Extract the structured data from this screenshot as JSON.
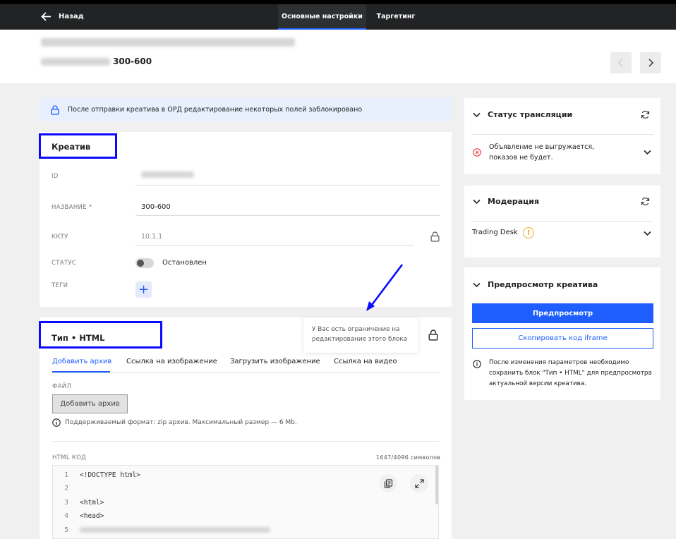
{
  "topbar": {
    "back_label": "Назад",
    "tabs": [
      {
        "label": "Основные настройки",
        "active": true
      },
      {
        "label": "Таргетинг",
        "active": false
      }
    ]
  },
  "header": {
    "title_suffix": "300-600"
  },
  "notice": {
    "text": "После отправки креатива в ОРД редактирование некоторых полей заблокировано"
  },
  "creative": {
    "title": "Креатив",
    "fields": {
      "id_label": "ID",
      "name_label": "НАЗВАНИЕ *",
      "name_value": "300-600",
      "kktu_label": "ККТУ",
      "kktu_value": "10.1.1",
      "status_label": "СТАТУС",
      "status_value": "Остановлен",
      "tags_label": "ТЕГИ"
    }
  },
  "type_block": {
    "title": "Тип • HTML",
    "tooltip": "У Вас есть ограничение на редактирование этого блока",
    "tabs": [
      "Добавить архив",
      "Ссылка на изображение",
      "Загрузить изображение",
      "Ссылка на видео"
    ],
    "file_label": "ФАЙЛ",
    "upload_button": "Добавить архив",
    "hint": "Поддерживаемый формат: zip архив. Максимальный размер — 6 Mb.",
    "code_label": "HTML КОД",
    "code_counter": "1647/4096 символов",
    "code_lines": [
      {
        "num": "1",
        "text": "<!DOCTYPE html>"
      },
      {
        "num": "2",
        "text": ""
      },
      {
        "num": "3",
        "text": "<html>"
      },
      {
        "num": "4",
        "text": "<head>"
      },
      {
        "num": "5",
        "text": ""
      }
    ]
  },
  "right_panel": {
    "broadcast": {
      "title": "Статус трансляции",
      "message": "Объявление не выгружается, показов не будет."
    },
    "moderation": {
      "title": "Модерация",
      "item": "Trading Desk",
      "badge": "!"
    },
    "preview": {
      "title": "Предпросмотр креатива",
      "preview_button": "Предпросмотр",
      "copy_button": "Скопировать код iframe",
      "note": "После изменения параметров необходимо сохранить блок \"Тип • HTML\" для предпросмотра актуальной версии креатива."
    }
  },
  "colors": {
    "accent": "#1e5eff",
    "annotation": "#0a0aff",
    "error": "#e53935",
    "warning": "#f5a623"
  }
}
